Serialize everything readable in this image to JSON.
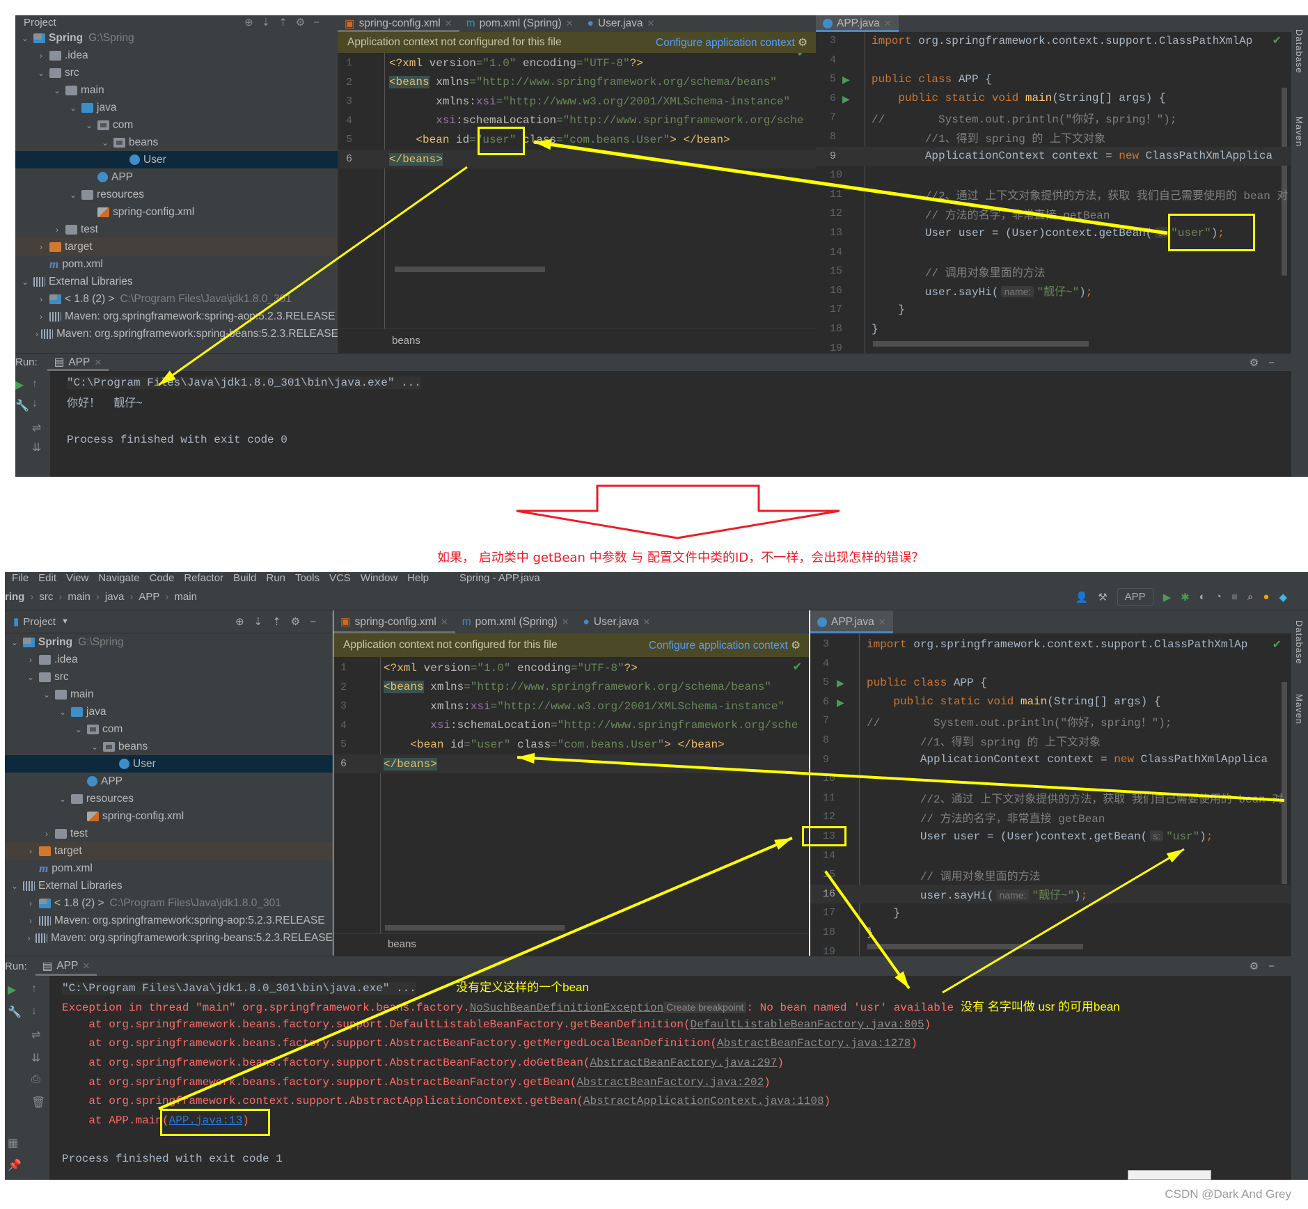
{
  "top": {
    "project_label": "Project",
    "tree": [
      {
        "label": "Spring",
        "sub": "G:\\Spring",
        "level": 0,
        "arrow": "open",
        "icon": "module",
        "bold": true
      },
      {
        "label": ".idea",
        "level": 1,
        "arrow": "closed",
        "icon": "folder"
      },
      {
        "label": "src",
        "level": 1,
        "arrow": "open",
        "icon": "folder"
      },
      {
        "label": "main",
        "level": 2,
        "arrow": "open",
        "icon": "folder"
      },
      {
        "label": "java",
        "level": 3,
        "arrow": "open",
        "icon": "folder-blue"
      },
      {
        "label": "com",
        "level": 4,
        "arrow": "open",
        "icon": "package"
      },
      {
        "label": "beans",
        "level": 5,
        "arrow": "open",
        "icon": "package"
      },
      {
        "label": "User",
        "level": 6,
        "arrow": "",
        "icon": "class",
        "state": "selected"
      },
      {
        "label": "APP",
        "level": 4,
        "arrow": "",
        "icon": "class"
      },
      {
        "label": "resources",
        "level": 3,
        "arrow": "open",
        "icon": "folder"
      },
      {
        "label": "spring-config.xml",
        "level": 4,
        "arrow": "",
        "icon": "xml"
      },
      {
        "label": "test",
        "level": 2,
        "arrow": "closed",
        "icon": "folder"
      },
      {
        "label": "target",
        "level": 1,
        "arrow": "closed",
        "icon": "folder-orange",
        "state": "target"
      },
      {
        "label": "pom.xml",
        "level": 1,
        "arrow": "",
        "icon": "maven"
      },
      {
        "label": "External Libraries",
        "level": 0,
        "arrow": "open",
        "icon": "library"
      },
      {
        "label": "< 1.8 (2) >",
        "sub": "C:\\Program Files\\Java\\jdk1.8.0_301",
        "level": 1,
        "arrow": "closed",
        "icon": "jdk"
      },
      {
        "label": "Maven: org.springframework:spring-aop:5.2.3.RELEASE",
        "level": 1,
        "arrow": "closed",
        "icon": "library"
      },
      {
        "label": "Maven: org.springframework:spring-beans:5.2.3.RELEASE",
        "level": 1,
        "arrow": "closed",
        "icon": "library"
      }
    ],
    "xml_tabs": [
      {
        "label": "spring-config.xml",
        "icon": "xml-file-icon",
        "active": true
      },
      {
        "label": "pom.xml (Spring)",
        "icon": "maven-icon"
      },
      {
        "label": "User.java",
        "icon": "class-icon"
      }
    ],
    "java_tab": "APP.java",
    "banner": {
      "text": "Application context not configured for this file",
      "link": "Configure application context"
    },
    "xml_lines": [
      {
        "n": "1",
        "tokens": [
          {
            "t": "<?xml ",
            "k": "tag"
          },
          {
            "t": "version",
            "k": "attr"
          },
          {
            "t": "=\"1.0\" ",
            "k": "str"
          },
          {
            "t": "encoding",
            "k": "attr"
          },
          {
            "t": "=\"UTF-8\"",
            "k": "str"
          },
          {
            "t": "?>",
            "k": "tag"
          }
        ]
      },
      {
        "n": "2",
        "tokens": [
          {
            "t": "<beans",
            "k": "tagm"
          },
          {
            "t": " xmlns",
            "k": "attr"
          },
          {
            "t": "=\"http://www.springframework.org/schema/beans\"",
            "k": "str"
          }
        ]
      },
      {
        "n": "3",
        "tokens": [
          {
            "t": "       xmlns:",
            "k": "attr"
          },
          {
            "t": "xsi",
            "k": "ns"
          },
          {
            "t": "=\"http://www.w3.org/2001/XMLSchema-instance\"",
            "k": "str"
          }
        ]
      },
      {
        "n": "4",
        "tokens": [
          {
            "t": "       ",
            "k": "plain"
          },
          {
            "t": "xsi",
            "k": "ns"
          },
          {
            "t": ":schemaLocation",
            "k": "attr"
          },
          {
            "t": "=\"http://www.springframework.org/sche",
            "k": "str"
          }
        ]
      },
      {
        "n": "5",
        "tokens": [
          {
            "t": "    <bean ",
            "k": "tag"
          },
          {
            "t": "id",
            "k": "attr"
          },
          {
            "t": "=\"user\" ",
            "k": "str"
          },
          {
            "t": "class",
            "k": "attr"
          },
          {
            "t": "=\"com.beans.User\"",
            "k": "str"
          },
          {
            "t": "> </bean>",
            "k": "tag"
          }
        ]
      },
      {
        "n": "6",
        "tokens": [
          {
            "t": "</beans>",
            "k": "tagm"
          }
        ]
      }
    ],
    "xml_breadcrumb": "beans",
    "java_lines": [
      {
        "n": "3",
        "tokens": [
          {
            "t": "import ",
            "k": "kw"
          },
          {
            "t": "org.springframework.context.support.ClassPathXmlAp",
            "k": "plain"
          }
        ]
      },
      {
        "n": "4",
        "tokens": []
      },
      {
        "n": "5",
        "tokens": [
          {
            "t": "public class ",
            "k": "kw"
          },
          {
            "t": "APP {",
            "k": "plain"
          }
        ]
      },
      {
        "n": "6",
        "tokens": [
          {
            "t": "    public static void ",
            "k": "kw"
          },
          {
            "t": "main",
            "k": "fn"
          },
          {
            "t": "(String[] args) {",
            "k": "plain"
          }
        ]
      },
      {
        "n": "7",
        "tokens": [
          {
            "t": "//        System.out.println(\"你好，spring！\");",
            "k": "cm"
          }
        ]
      },
      {
        "n": "8",
        "tokens": [
          {
            "t": "        //1、得到 spring 的 上下文对象",
            "k": "cm"
          }
        ]
      },
      {
        "n": "9",
        "tokens": [
          {
            "t": "        ApplicationContext context = ",
            "k": "plain"
          },
          {
            "t": "new ",
            "k": "kw"
          },
          {
            "t": "ClassPathXmlApplica",
            "k": "plain"
          }
        ]
      },
      {
        "n": "10",
        "tokens": []
      },
      {
        "n": "11",
        "tokens": [
          {
            "t": "        //2、通过 上下文对象提供的方法，获取 我们自己需要使用的 bean 对",
            "k": "cm"
          }
        ]
      },
      {
        "n": "12",
        "tokens": [
          {
            "t": "        // 方法的名字，非常直接 getBean",
            "k": "cm"
          }
        ]
      },
      {
        "n": "13",
        "tokens": [
          {
            "t": "        User user = (User)context.getBean(",
            "k": "plain"
          },
          {
            "t": "s:",
            "k": "hint"
          },
          {
            "t": "\"user\"",
            "k": "str"
          },
          {
            "t": ")",
            "k": "plain"
          },
          {
            "t": ";",
            "k": "kw"
          }
        ]
      },
      {
        "n": "14",
        "tokens": []
      },
      {
        "n": "15",
        "tokens": [
          {
            "t": "        // 调用对象里面的方法",
            "k": "cm"
          }
        ]
      },
      {
        "n": "16",
        "tokens": [
          {
            "t": "        user.sayHi(",
            "k": "plain"
          },
          {
            "t": "name:",
            "k": "hint"
          },
          {
            "t": "\"靓仔~\"",
            "k": "str"
          },
          {
            "t": ")",
            "k": "plain"
          },
          {
            "t": ";",
            "k": "kw"
          }
        ]
      },
      {
        "n": "17",
        "tokens": [
          {
            "t": "    }",
            "k": "plain"
          }
        ]
      },
      {
        "n": "18",
        "tokens": [
          {
            "t": "}",
            "k": "plain"
          }
        ]
      },
      {
        "n": "19",
        "tokens": []
      }
    ],
    "run_label": "Run:",
    "run_tab": "APP",
    "console": [
      {
        "tokens": [
          {
            "t": "\"C:\\Program Files\\Java\\jdk1.8.0_301\\bin\\java.exe\" ...",
            "k": "cmd"
          }
        ]
      },
      {
        "tokens": [
          {
            "t": "你好！  靓仔~",
            "k": "plain"
          }
        ]
      },
      {
        "tokens": []
      },
      {
        "tokens": [
          {
            "t": "Process finished with exit code 0",
            "k": "plain"
          }
        ]
      }
    ],
    "side_tabs": [
      "Database",
      "Maven"
    ]
  },
  "middle": {
    "question": "如果， 启动类中 getBean 中参数 与 配置文件中类的ID，不一样，会出现怎样的错误？",
    "arrow_color": "#ee1c25"
  },
  "bottom": {
    "menu": [
      "File",
      "Edit",
      "View",
      "Navigate",
      "Code",
      "Refactor",
      "Build",
      "Run",
      "Tools",
      "VCS",
      "Window",
      "Help"
    ],
    "window_title": "Spring - APP.java",
    "breadcrumb": [
      "ring",
      "src",
      "main",
      "java",
      "APP",
      "main"
    ],
    "run_config": "APP",
    "project_label": "Project",
    "java_tab": "APP.java",
    "java_lines": [
      {
        "n": "3",
        "tokens": [
          {
            "t": "import ",
            "k": "kw"
          },
          {
            "t": "org.springframework.context.support.ClassPathXmlAp",
            "k": "plain"
          }
        ]
      },
      {
        "n": "4",
        "tokens": []
      },
      {
        "n": "5",
        "tokens": [
          {
            "t": "public class ",
            "k": "kw"
          },
          {
            "t": "APP {",
            "k": "plain"
          }
        ]
      },
      {
        "n": "6",
        "tokens": [
          {
            "t": "    public static void ",
            "k": "kw"
          },
          {
            "t": "main",
            "k": "fn"
          },
          {
            "t": "(String[] args) {",
            "k": "plain"
          }
        ]
      },
      {
        "n": "7",
        "tokens": [
          {
            "t": "//        System.out.println(\"你好，spring！\");",
            "k": "cm"
          }
        ]
      },
      {
        "n": "8",
        "tokens": [
          {
            "t": "        //1、得到 spring 的 上下文对象",
            "k": "cm"
          }
        ]
      },
      {
        "n": "9",
        "tokens": [
          {
            "t": "        ApplicationContext context = ",
            "k": "plain"
          },
          {
            "t": "new ",
            "k": "kw"
          },
          {
            "t": "ClassPathXmlApplica",
            "k": "plain"
          }
        ]
      },
      {
        "n": "10",
        "tokens": []
      },
      {
        "n": "11",
        "tokens": [
          {
            "t": "        //2、通过 上下文对象提供的方法，获取 我们自己需要使用的 bean 对",
            "k": "cm"
          }
        ]
      },
      {
        "n": "12",
        "tokens": [
          {
            "t": "        // 方法的名字，非常直接 getBean",
            "k": "cm"
          }
        ]
      },
      {
        "n": "13",
        "tokens": [
          {
            "t": "        User user = (User)context.getBean(",
            "k": "plain"
          },
          {
            "t": "s:",
            "k": "hint"
          },
          {
            "t": "\"usr\"",
            "k": "str"
          },
          {
            "t": ")",
            "k": "plain"
          },
          {
            "t": ";",
            "k": "kw"
          }
        ]
      },
      {
        "n": "14",
        "tokens": []
      },
      {
        "n": "15",
        "tokens": [
          {
            "t": "        // 调用对象里面的方法",
            "k": "cm"
          }
        ]
      },
      {
        "n": "16",
        "tokens": [
          {
            "t": "        user.sayHi(",
            "k": "plain"
          },
          {
            "t": "name:",
            "k": "hint"
          },
          {
            "t": "\"靓仔~\"",
            "k": "str"
          },
          {
            "t": ")",
            "k": "plain"
          },
          {
            "t": ";",
            "k": "kw"
          }
        ]
      },
      {
        "n": "17",
        "tokens": [
          {
            "t": "    }",
            "k": "plain"
          }
        ]
      },
      {
        "n": "18",
        "tokens": [
          {
            "t": "}",
            "k": "plain"
          }
        ]
      },
      {
        "n": "19",
        "tokens": []
      }
    ],
    "run_tab": "APP",
    "console": [
      {
        "tokens": [
          {
            "t": "\"C:\\Program Files\\Java\\jdk1.8.0_301\\bin\\java.exe\" ...",
            "k": "cmd"
          },
          {
            "t": "          没有定义这样的一个bean",
            "k": "note"
          }
        ]
      },
      {
        "tokens": [
          {
            "t": "Exception in thread \"main\" org.springframework.beans.factory.",
            "k": "err"
          },
          {
            "t": "NoSuchBeanDefinitionException",
            "k": "glink"
          },
          {
            "t": "Create breakpoint",
            "k": "btn"
          },
          {
            "t": ": No bean named 'usr' available",
            "k": "err"
          },
          {
            "t": "没有 名字叫做 usr 的可用bean",
            "k": "note"
          }
        ]
      },
      {
        "tokens": [
          {
            "t": "    at org.springframework.beans.factory.support.DefaultListableBeanFactory.getBeanDefinition(",
            "k": "err"
          },
          {
            "t": "DefaultListableBeanFactory.java:805",
            "k": "glink"
          },
          {
            "t": ")",
            "k": "err"
          }
        ]
      },
      {
        "tokens": [
          {
            "t": "    at org.springframework.beans.factory.support.AbstractBeanFactory.getMergedLocalBeanDefinition(",
            "k": "err"
          },
          {
            "t": "AbstractBeanFactory.java:1278",
            "k": "glink"
          },
          {
            "t": ")",
            "k": "err"
          }
        ]
      },
      {
        "tokens": [
          {
            "t": "    at org.springframework.beans.factory.support.AbstractBeanFactory.doGetBean(",
            "k": "err"
          },
          {
            "t": "AbstractBeanFactory.java:297",
            "k": "glink"
          },
          {
            "t": ")",
            "k": "err"
          }
        ]
      },
      {
        "tokens": [
          {
            "t": "    at org.springframework.beans.factory.support.AbstractBeanFactory.getBean(",
            "k": "err"
          },
          {
            "t": "AbstractBeanFactory.java:202",
            "k": "glink"
          },
          {
            "t": ")",
            "k": "err"
          }
        ]
      },
      {
        "tokens": [
          {
            "t": "    at org.springframework.context.support.AbstractApplicationContext.getBean(",
            "k": "err"
          },
          {
            "t": "AbstractApplicationContext.java:1108",
            "k": "glink"
          },
          {
            "t": ")",
            "k": "err"
          }
        ]
      },
      {
        "tokens": [
          {
            "t": "    at APP.main(",
            "k": "err"
          },
          {
            "t": "APP.java:13",
            "k": "link"
          },
          {
            "t": ")",
            "k": "err"
          }
        ]
      },
      {
        "tokens": []
      },
      {
        "tokens": [
          {
            "t": "Process finished with exit code 1",
            "k": "plain"
          }
        ]
      }
    ]
  },
  "watermark": "CSDN @Dark And Grey",
  "colors": {
    "annotation": "#ffff00",
    "ide_bg": "#2b2b2b",
    "panel_bg": "#3c3f41",
    "error": "#ff6b68"
  }
}
